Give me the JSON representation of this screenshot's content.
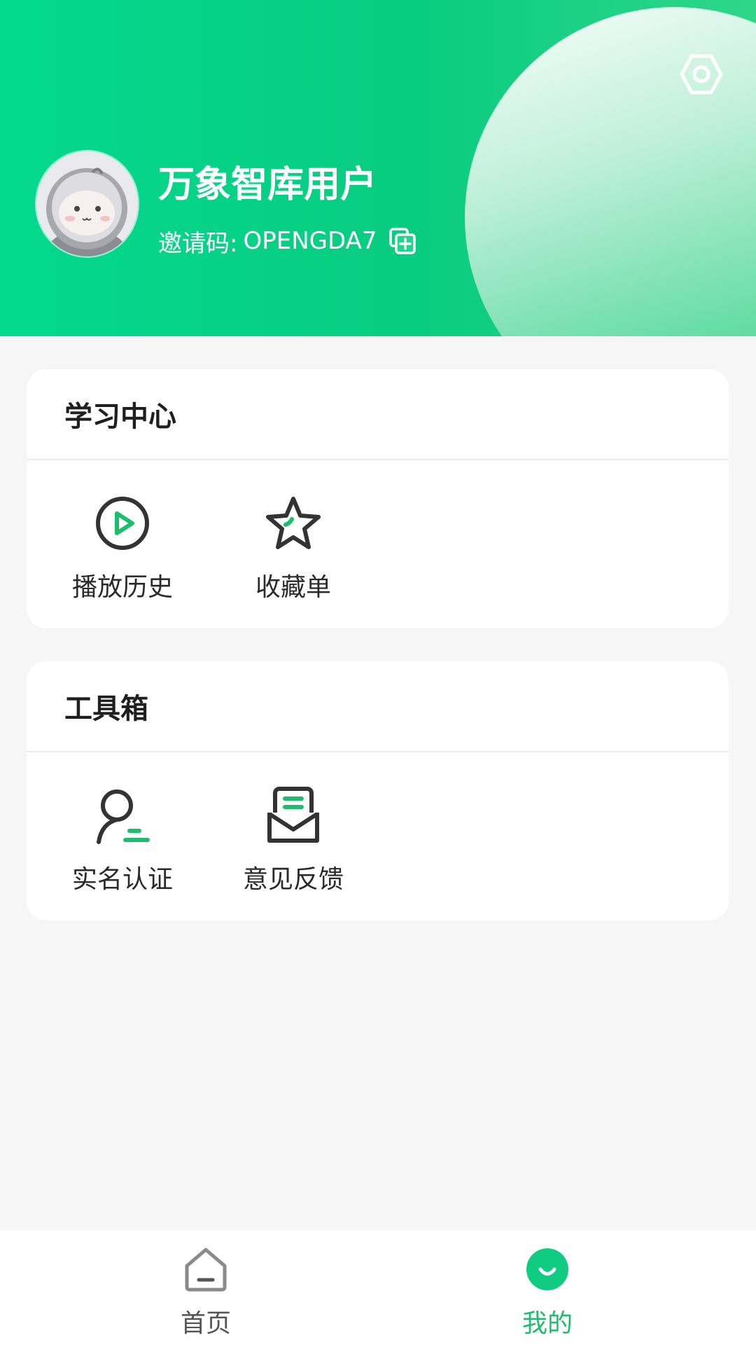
{
  "header": {
    "username": "万象智库用户",
    "invite_label": "邀请码:",
    "invite_code": "OPENGDA7"
  },
  "learning_center": {
    "title": "学习中心",
    "items": [
      {
        "label": "播放历史",
        "icon": "play-circle-icon"
      },
      {
        "label": "收藏单",
        "icon": "star-icon"
      }
    ]
  },
  "toolbox": {
    "title": "工具箱",
    "items": [
      {
        "label": "实名认证",
        "icon": "user-verify-icon"
      },
      {
        "label": "意见反馈",
        "icon": "mail-feedback-icon"
      }
    ]
  },
  "tabbar": {
    "tabs": [
      {
        "label": "首页",
        "icon": "home-icon",
        "active": false
      },
      {
        "label": "我的",
        "icon": "smile-icon",
        "active": true
      }
    ]
  },
  "colors": {
    "brand": "#08cc7f",
    "text": "#2a2a2a",
    "tab_inactive": "#555555",
    "tab_active": "#1ebd6e"
  }
}
